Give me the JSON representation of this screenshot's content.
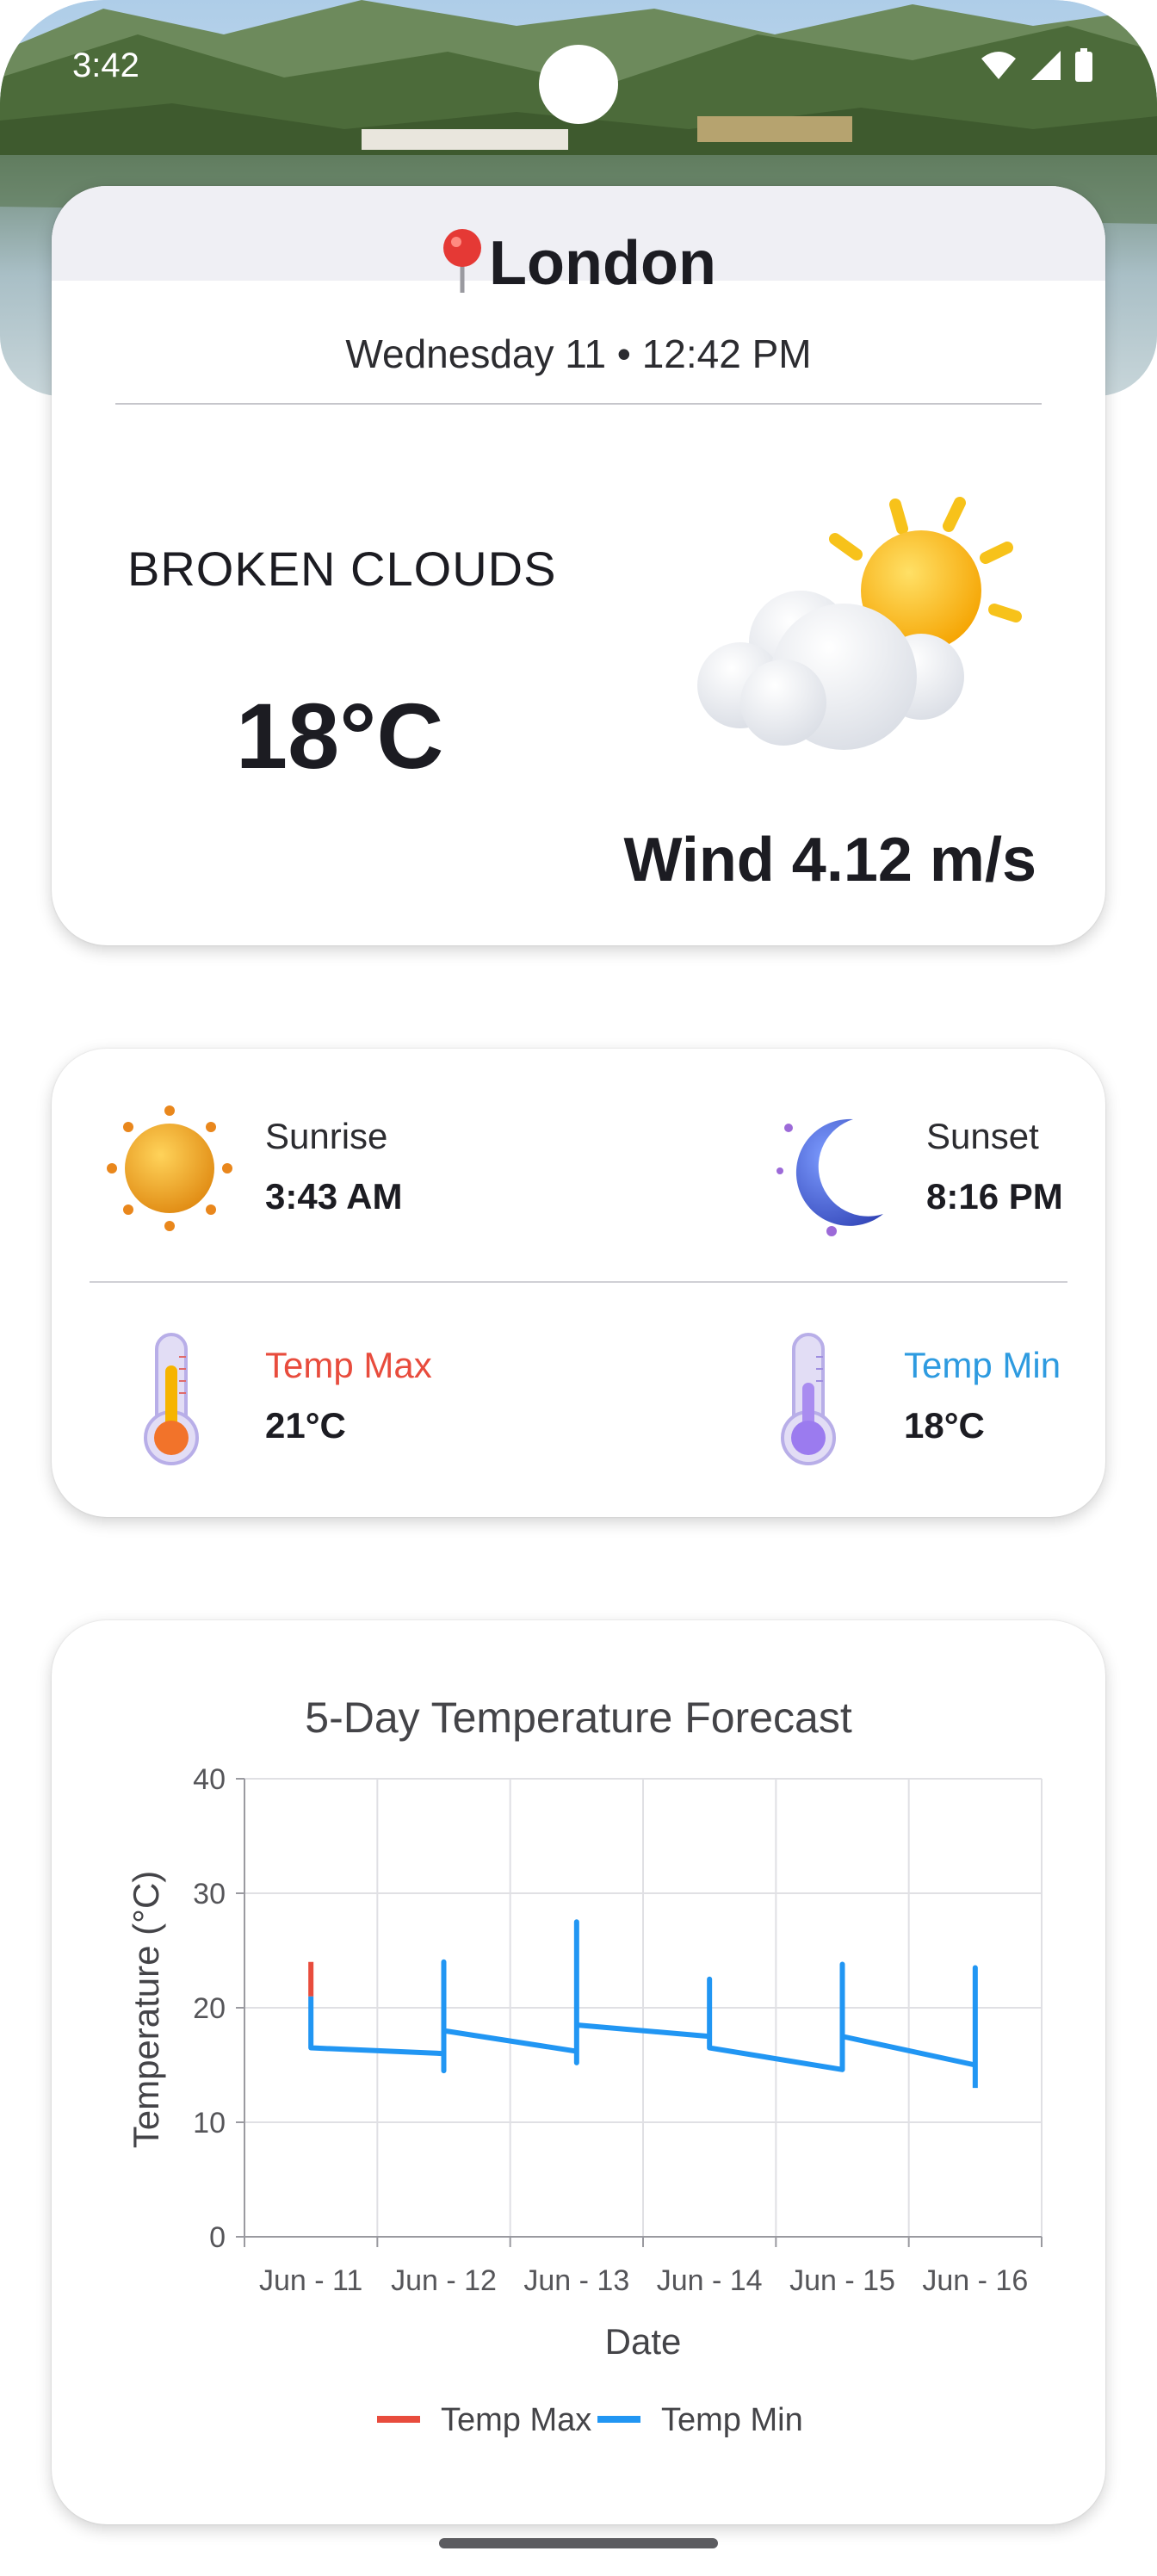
{
  "status_bar": {
    "time": "3:42"
  },
  "location": {
    "city": "London",
    "date_time": "Wednesday 11 • 12:42 PM"
  },
  "current": {
    "condition": "BROKEN CLOUDS",
    "temperature": "18°C",
    "wind": "Wind 4.12 m/s"
  },
  "sun": {
    "sunrise_label": "Sunrise",
    "sunrise_value": "3:43 AM",
    "sunset_label": "Sunset",
    "sunset_value": "8:16 PM"
  },
  "temps": {
    "max_label": "Temp Max",
    "max_value": "21°C",
    "min_label": "Temp Min",
    "min_value": "18°C"
  },
  "colors": {
    "temp_max": "#e84c3d",
    "temp_min": "#2196f3"
  },
  "chart_data": {
    "type": "line",
    "title": "5-Day Temperature Forecast",
    "xlabel": "Date",
    "ylabel": "Temperature (°C)",
    "ylim": [
      0,
      40
    ],
    "yticks": [
      0,
      10,
      20,
      30,
      40
    ],
    "categories": [
      "Jun - 11",
      "Jun - 12",
      "Jun - 13",
      "Jun - 14",
      "Jun - 15",
      "Jun - 16"
    ],
    "grid": true,
    "legend": "bottom",
    "series": [
      {
        "name": "Temp Max",
        "color": "#e84c3d",
        "points": [
          [
            0,
            24.0
          ],
          [
            0,
            21.0
          ]
        ]
      },
      {
        "name": "Temp Min",
        "color": "#2196f3",
        "points": [
          [
            0,
            21.0
          ],
          [
            0,
            16.5
          ],
          [
            1,
            16.0
          ],
          [
            1,
            24.0
          ],
          [
            1,
            14.5
          ],
          [
            1,
            18.0
          ],
          [
            2,
            16.2
          ],
          [
            2,
            27.5
          ],
          [
            2,
            15.2
          ],
          [
            2,
            18.5
          ],
          [
            3,
            17.5
          ],
          [
            3,
            22.5
          ],
          [
            3,
            16.5
          ],
          [
            4,
            14.6
          ],
          [
            4,
            23.8
          ],
          [
            4,
            17.5
          ],
          [
            5,
            15.0
          ],
          [
            5,
            23.5
          ],
          [
            5,
            13.0
          ]
        ]
      }
    ]
  }
}
